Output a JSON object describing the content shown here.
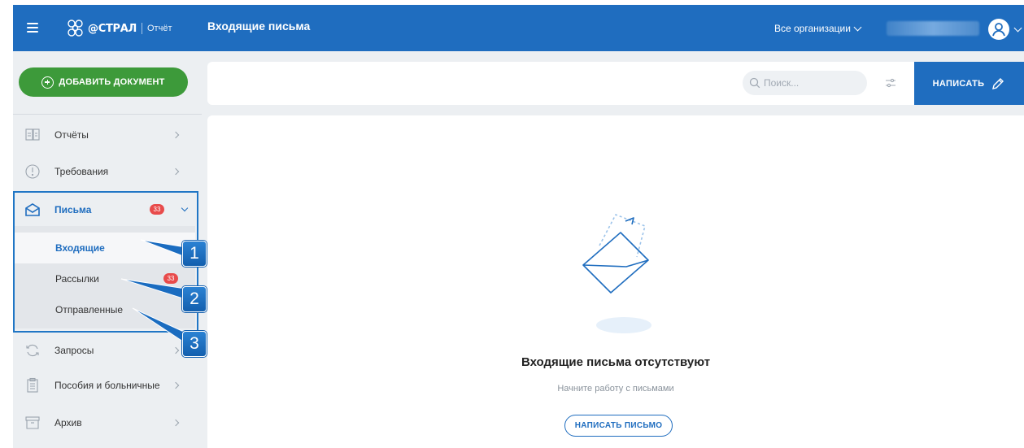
{
  "app": {
    "logo_text": "@СТРАЛ",
    "logo_sub": "Отчёт",
    "page_title": "Входящие письма",
    "org_select": "Все организации"
  },
  "sidebar": {
    "add_document": "ДОБАВИТЬ ДОКУМЕНТ",
    "items": [
      {
        "label": "Отчёты",
        "icon": "reports-icon"
      },
      {
        "label": "Требования",
        "icon": "requirements-icon"
      },
      {
        "label": "Письма",
        "icon": "envelope-icon",
        "badge": "33",
        "expanded": true
      },
      {
        "label": "Запросы",
        "icon": "refresh-icon"
      },
      {
        "label": "Пособия и больничные",
        "icon": "clipboard-icon"
      },
      {
        "label": "Архив",
        "icon": "archive-icon"
      }
    ],
    "letters_sub": [
      {
        "label": "Входящие",
        "active": true
      },
      {
        "label": "Рассылки",
        "badge": "33"
      },
      {
        "label": "Отправленные"
      }
    ]
  },
  "annotations": [
    "1",
    "2",
    "3"
  ],
  "toolbar": {
    "search_placeholder": "Поиск...",
    "write_label": "НАПИСАТЬ"
  },
  "empty_state": {
    "title": "Входящие письма отсутствуют",
    "subtitle": "Начните работу с письмами",
    "button": "НАПИСАТЬ ПИСЬМО"
  },
  "colors": {
    "brand_blue": "#1f6dbf",
    "add_green": "#3d9a3a",
    "badge_red": "#e84b4b",
    "callout_blue": "#1a6cc0"
  }
}
